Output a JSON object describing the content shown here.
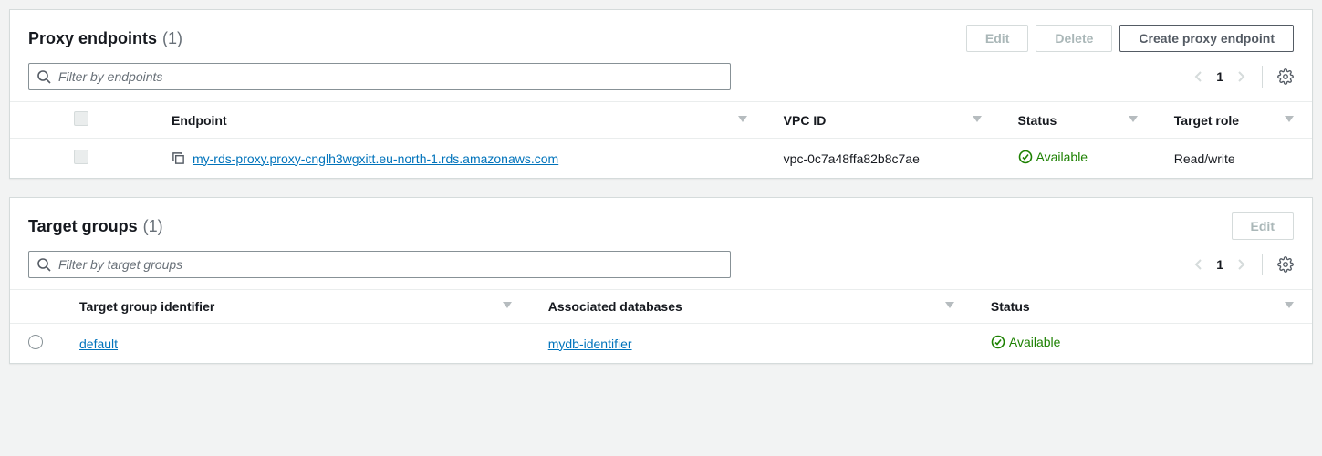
{
  "proxy_endpoints": {
    "title": "Proxy endpoints",
    "count": "(1)",
    "edit_label": "Edit",
    "delete_label": "Delete",
    "create_label": "Create proxy endpoint",
    "filter_placeholder": "Filter by endpoints",
    "page": "1",
    "columns": {
      "endpoint": "Endpoint",
      "vpc": "VPC ID",
      "status": "Status",
      "target_role": "Target role"
    },
    "row": {
      "endpoint": "my-rds-proxy.proxy-cnglh3wgxitt.eu-north-1.rds.amazonaws.com",
      "vpc": "vpc-0c7a48ffa82b8c7ae",
      "status": "Available",
      "target_role": "Read/write"
    }
  },
  "target_groups": {
    "title": "Target groups",
    "count": "(1)",
    "edit_label": "Edit",
    "filter_placeholder": "Filter by target groups",
    "page": "1",
    "columns": {
      "identifier": "Target group identifier",
      "dbs": "Associated databases",
      "status": "Status"
    },
    "row": {
      "identifier": "default",
      "db": "mydb-identifier",
      "status": "Available"
    }
  }
}
